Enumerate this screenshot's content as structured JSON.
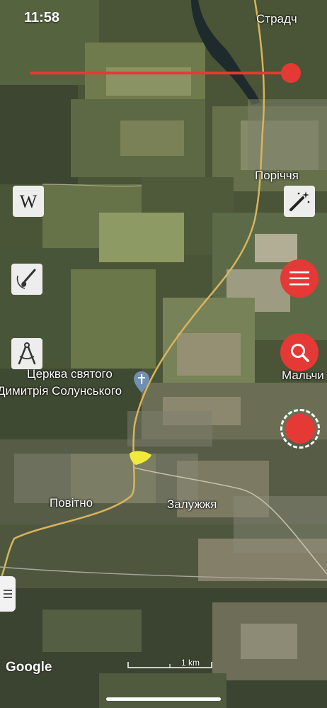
{
  "status": {
    "time": "11:58"
  },
  "map": {
    "places": {
      "stradch": "Страдч",
      "porichchia": "Поріччя",
      "church_line1": "Церква святого",
      "church_line2": "Димитрія Солунського",
      "malchytsi": "Мальчи",
      "povitno": "Повітно",
      "zaluzhzhia": "Залужжя"
    },
    "attribution": "Google",
    "scale_label": "1 km"
  },
  "controls": {
    "left_tools": [
      "wikipedia-icon",
      "paint-brush-icon",
      "compass-divider-icon"
    ],
    "right_tools": [
      "magic-wand-icon",
      "menu-icon",
      "search-icon",
      "record-icon"
    ],
    "accent_color": "#e53935"
  }
}
